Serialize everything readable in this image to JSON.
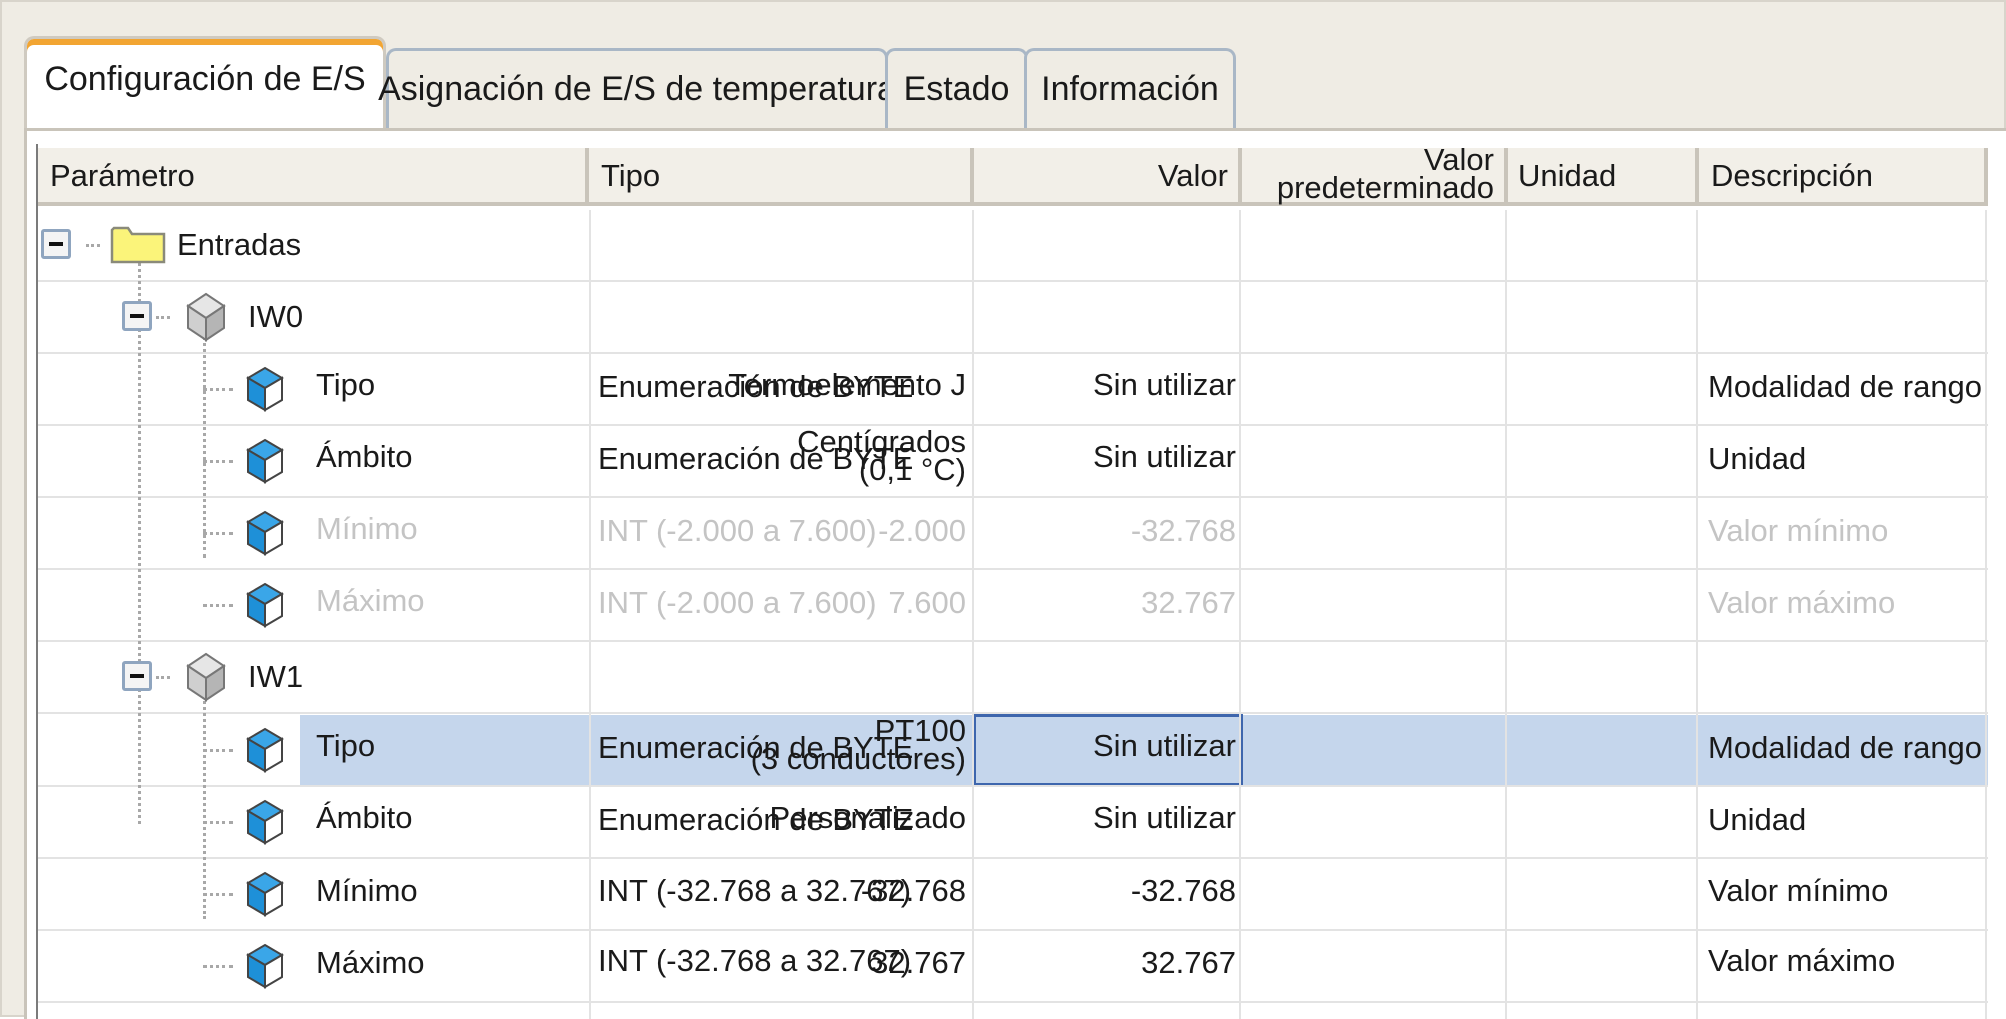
{
  "tabs": [
    {
      "label": "Configuración de E/S",
      "active": true
    },
    {
      "label": "Asignación de E/S de temperatura",
      "active": false
    },
    {
      "label": "Estado",
      "active": false
    },
    {
      "label": "Información",
      "active": false
    }
  ],
  "columns": {
    "parametro": "Parámetro",
    "tipo": "Tipo",
    "valor": "Valor",
    "valor_predeterminado_1": "Valor",
    "valor_predeterminado_2": "predeterminado",
    "unidad": "Unidad",
    "descripcion": "Descripción"
  },
  "tree": {
    "root": {
      "label": "Entradas",
      "icon": "folder-icon",
      "expanded": true
    },
    "groups": [
      {
        "label": "IW0",
        "icon": "cube-gray-icon",
        "expanded": true,
        "rows": [
          {
            "name": "Tipo",
            "type": "Enumeración de BYTE",
            "value": "Termoelemento J",
            "value2": "",
            "default": "Sin utilizar",
            "unit": "",
            "description": "Modalidad de rango",
            "disabled": false
          },
          {
            "name": "Ámbito",
            "type": "Enumeración de BYTE",
            "value": "Centígrados",
            "value2": "(0,1 °C)",
            "default": "Sin utilizar",
            "unit": "",
            "description": "Unidad",
            "disabled": false
          },
          {
            "name": "Mínimo",
            "type": "INT (-2.000 a 7.600)",
            "value": "-2.000",
            "value2": "",
            "default": "-32.768",
            "unit": "",
            "description": "Valor mínimo",
            "disabled": true
          },
          {
            "name": "Máximo",
            "type": "INT (-2.000 a 7.600)",
            "value": "7.600",
            "value2": "",
            "default": "32.767",
            "unit": "",
            "description": "Valor máximo",
            "disabled": true
          }
        ]
      },
      {
        "label": "IW1",
        "icon": "cube-gray-icon",
        "expanded": true,
        "rows": [
          {
            "name": "Tipo",
            "type": "Enumeración de BYTE",
            "value": "PT100",
            "value2": "(3 conductores)",
            "default": "Sin utilizar",
            "unit": "",
            "description": "Modalidad de rango",
            "disabled": false,
            "selected": true
          },
          {
            "name": "Ámbito",
            "type": "Enumeración de BYTE",
            "value": "Personalizado",
            "value2": "",
            "default": "Sin utilizar",
            "unit": "",
            "description": "Unidad",
            "disabled": false
          },
          {
            "name": "Mínimo",
            "type": "INT (-32.768 a 32.767)",
            "value": "-32.768",
            "value2": "",
            "default": "-32.768",
            "unit": "",
            "description": "Valor mínimo",
            "disabled": false
          },
          {
            "name": "Máximo",
            "type": "INT (-32.768 a 32.767)",
            "value": "32.767",
            "value2": "",
            "default": "32.767",
            "unit": "",
            "description": "Valor máximo",
            "disabled": false
          }
        ]
      }
    ]
  },
  "colors": {
    "selection": "#c5d6ec",
    "edit_border": "#3e66ad",
    "disabled_text": "#c4c4c4",
    "active_tab_accent": "#f2a532",
    "param_icon": "#1e90d8"
  }
}
